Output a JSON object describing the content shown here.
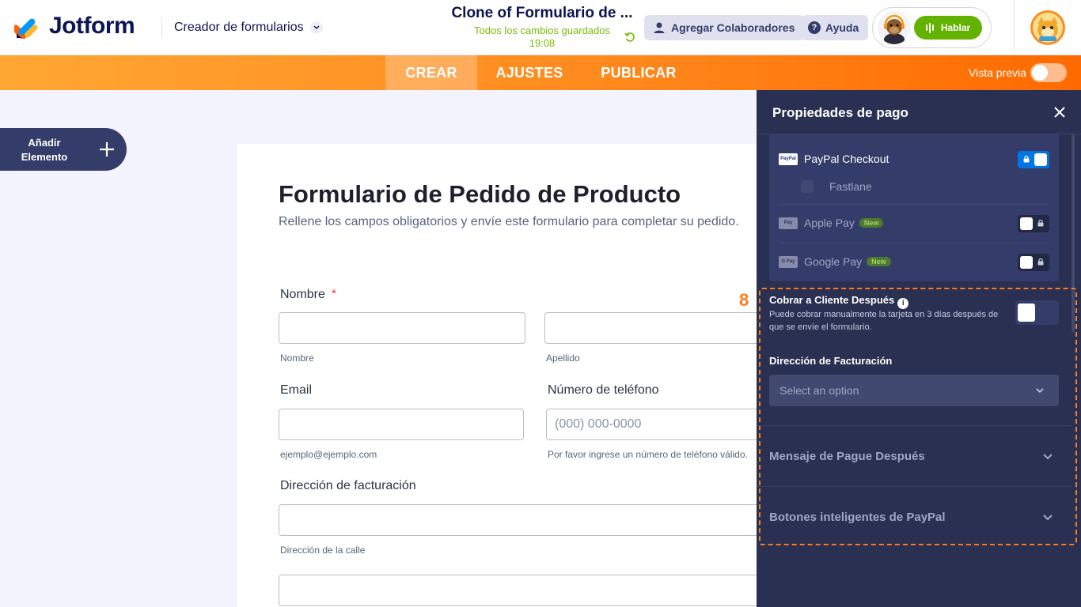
{
  "header": {
    "logo_text": "Jotform",
    "builder_label": "Creador de formularios",
    "form_name": "Clone of Formulario de ...",
    "saved_status": "Todos los cambios guardados",
    "saved_time": "19:08",
    "collab_button": "Agregar Colaboradores",
    "help_button": "Ayuda",
    "talk_button": "Hablar"
  },
  "nav": {
    "tabs": [
      {
        "label": "CREAR",
        "active": true
      },
      {
        "label": "AJUSTES",
        "active": false
      },
      {
        "label": "PUBLICAR",
        "active": false
      }
    ],
    "preview_label": "Vista previa"
  },
  "sidebar": {
    "add_element_label": "Añadir Elemento"
  },
  "form": {
    "title": "Formulario de Pedido de Producto",
    "subtitle": "Rellene los campos obligatorios y envíe este formulario para completar su pedido.",
    "name_label": "Nombre",
    "required_mark": "*",
    "first_name_help": "Nombre",
    "last_name_help": "Apellido",
    "email_label": "Email",
    "email_help": "ejemplo@ejemplo.com",
    "phone_label": "Número de teléfono",
    "phone_placeholder": "(000) 000-0000",
    "phone_help": "Por favor ingrese un número de teléfono válido.",
    "billing_label": "Dirección de facturación",
    "street_help": "Dirección de la calle"
  },
  "panel": {
    "title": "Propiedades de pago",
    "payments": [
      {
        "name": "PayPal Checkout",
        "icon_text": "PayPal",
        "badge": "",
        "enabled": true
      },
      {
        "name": "Apple Pay",
        "icon_text": "Pay",
        "badge": "New",
        "enabled": false
      },
      {
        "name": "Google Pay",
        "icon_text": "G Pay",
        "badge": "New",
        "enabled": false
      }
    ],
    "fastlane_label": "Fastlane",
    "step_number": "8",
    "charge_later_label": "Cobrar a Cliente Después",
    "charge_later_desc": "Puede cobrar manualmente la tarjeta en 3 días después de que se envíe el formulario.",
    "billing_address_label": "Dirección de Facturación",
    "billing_select_placeholder": "Select an option",
    "accordion": [
      "Mensaje de Pague Después",
      "Botones inteligentes de PayPal"
    ]
  },
  "colors": {
    "brand_navy": "#0a1551",
    "orange": "#ff7a1a",
    "panel_bg": "#293051",
    "green": "#64b200",
    "toggle_on": "#0075e3"
  }
}
